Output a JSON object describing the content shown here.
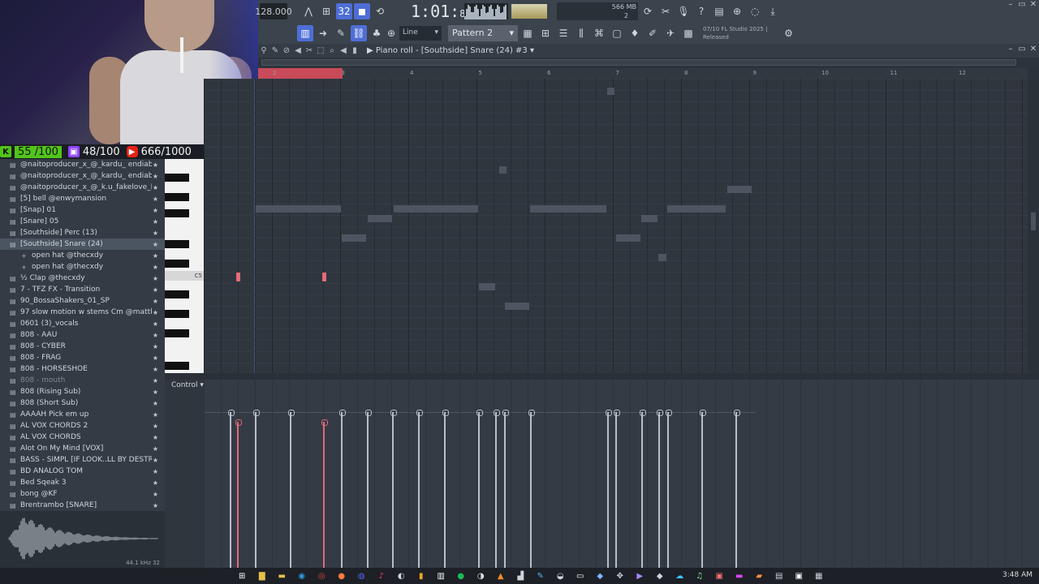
{
  "stats": {
    "kick": "55 /100",
    "twitch": "48/100",
    "youtube": "666/1000"
  },
  "topbar": {
    "tempo": "128.000",
    "time_main": "1:01",
    "time_sub": "83",
    "mem": "566 MB",
    "cpu_voices": "2"
  },
  "toolbar2": {
    "snap": "Line",
    "pattern": "Pattern 2",
    "info_line1": "07/10  FL Studio 2025 |",
    "info_line2": "Released"
  },
  "pianoroll": {
    "title": "Piano roll - [Southside] Snare (24) #3"
  },
  "ruler": {
    "bars": [
      "2",
      "3",
      "4",
      "5",
      "6",
      "7",
      "8",
      "9",
      "10",
      "11",
      "12"
    ]
  },
  "keyboard": {
    "c5_label": "C5"
  },
  "control": {
    "label": "Control"
  },
  "browser": {
    "items": [
      {
        "label": "@naitoproducer_x_@_kardu_ endiablaa_fill",
        "type": "file"
      },
      {
        "label": "@naitoproducer_x_@_kardu_ endiablaa_fill",
        "type": "file"
      },
      {
        "label": "@naitoproducer_x_@_k.u_fakelove_Dm_vocals",
        "type": "file"
      },
      {
        "label": "[5] bell @enwymansion",
        "type": "file"
      },
      {
        "label": "[Snap] 01",
        "type": "file"
      },
      {
        "label": "[Snare] 05",
        "type": "file"
      },
      {
        "label": "[Southside] Perc (13)",
        "type": "file"
      },
      {
        "label": "[Southside] Snare (24)",
        "type": "selected"
      },
      {
        "label": "open hat @thecxdy",
        "type": "sub"
      },
      {
        "label": "open hat @thecxdy",
        "type": "sub"
      },
      {
        "label": "½ Clap @thecxdy",
        "type": "file"
      },
      {
        "label": "7 - TFZ FX - Transition",
        "type": "file"
      },
      {
        "label": "90_BossaShakers_01_SP",
        "type": "file"
      },
      {
        "label": "97 slow motion w stems Cm @mattkolb",
        "type": "file"
      },
      {
        "label": "0601 (3)_vocals",
        "type": "file"
      },
      {
        "label": "808 - AAU",
        "type": "file"
      },
      {
        "label": "808 - CYBER",
        "type": "file"
      },
      {
        "label": "808 - FRAG",
        "type": "file"
      },
      {
        "label": "808 - HORSESHOE",
        "type": "file"
      },
      {
        "label": "808 - mouth",
        "type": "dim"
      },
      {
        "label": "808 (Rising Sub)",
        "type": "file"
      },
      {
        "label": "808 (Short Sub)",
        "type": "file"
      },
      {
        "label": "AAAAH Pick em up",
        "type": "file"
      },
      {
        "label": "AL VOX CHORDS 2",
        "type": "file"
      },
      {
        "label": "AL VOX CHORDS",
        "type": "file"
      },
      {
        "label": "Alot On My Mind [VOX]",
        "type": "file"
      },
      {
        "label": "BASS - SIMPL [IF LOOK..LL BY DESTROY LONELY]",
        "type": "file"
      },
      {
        "label": "BD ANALOG TOM",
        "type": "file"
      },
      {
        "label": "Bed Sqeak 3",
        "type": "file"
      },
      {
        "label": "bong @KF",
        "type": "file"
      },
      {
        "label": "Brentrambo [SNARE]",
        "type": "file"
      }
    ],
    "preview_meta": "44.1 kHz 32"
  },
  "taskbar": {
    "time": "3:48 AM"
  },
  "colors": {
    "accent_red": "#e66a78",
    "loop_red": "#c94a59",
    "active_blue": "#4e6ed6"
  }
}
